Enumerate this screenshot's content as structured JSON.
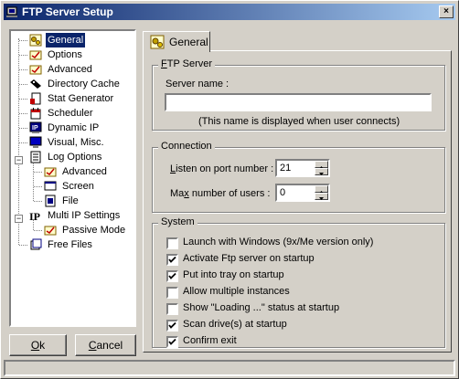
{
  "window": {
    "title": "FTP Server Setup",
    "close_label": "×"
  },
  "tree": {
    "items": [
      {
        "label": "General",
        "icon": "gear-icon",
        "selected": true
      },
      {
        "label": "Options",
        "icon": "options-icon"
      },
      {
        "label": "Advanced",
        "icon": "advanced-icon"
      },
      {
        "label": "Directory Cache",
        "icon": "cache-icon"
      },
      {
        "label": "Stat Generator",
        "icon": "stats-icon"
      },
      {
        "label": "Scheduler",
        "icon": "scheduler-icon"
      },
      {
        "label": "Dynamic IP",
        "icon": "ip-icon"
      },
      {
        "label": "Visual, Misc.",
        "icon": "monitor-icon"
      },
      {
        "label": "Log Options",
        "icon": "log-icon",
        "expander": "-"
      },
      {
        "label": "Advanced",
        "icon": "advanced-icon"
      },
      {
        "label": "Screen",
        "icon": "screen-icon"
      },
      {
        "label": "File",
        "icon": "file-icon"
      },
      {
        "label": "Multi IP Settings",
        "icon": "multi-ip-icon",
        "expander": "-"
      },
      {
        "label": "Passive Mode",
        "icon": "passive-icon"
      },
      {
        "label": "Free Files",
        "icon": "free-files-icon"
      }
    ]
  },
  "buttons": {
    "ok": "Ok",
    "cancel": "Cancel"
  },
  "tab": {
    "label": "General"
  },
  "ftp_server": {
    "title": "FTP Server",
    "server_name_label": "Server name :",
    "server_name_value": "",
    "hint": "(This name is displayed when user connects)"
  },
  "connection": {
    "title": "Connection",
    "port_label": "Listen on port number :",
    "port_value": "21",
    "max_users_label": "Max number of users :",
    "max_users_value": "0"
  },
  "system": {
    "title": "System",
    "options": [
      {
        "label": "Launch with Windows (9x/Me version only)",
        "checked": false
      },
      {
        "label": "Activate Ftp server on startup",
        "checked": true
      },
      {
        "label": "Put into tray on startup",
        "checked": true
      },
      {
        "label": "Allow multiple instances",
        "checked": false
      },
      {
        "label": "Show \"Loading ...\" status at startup",
        "checked": false
      },
      {
        "label": "Scan drive(s) at startup",
        "checked": true
      },
      {
        "label": "Confirm exit",
        "checked": true
      }
    ]
  }
}
